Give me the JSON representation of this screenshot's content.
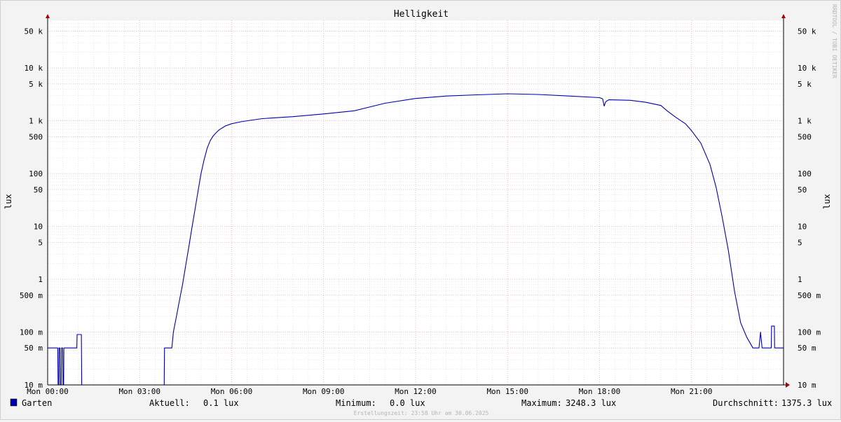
{
  "chart_data": {
    "type": "line",
    "title": "Helligkeit",
    "ylabel": "lux",
    "ylabel_right": "lux",
    "yscale": "log",
    "ylim": [
      0.01,
      80000
    ],
    "xlim_hours": [
      0,
      24
    ],
    "x_tick_labels": [
      "Mon 00:00",
      "Mon 03:00",
      "Mon 06:00",
      "Mon 09:00",
      "Mon 12:00",
      "Mon 15:00",
      "Mon 18:00",
      "Mon 21:00"
    ],
    "x_tick_hours": [
      0,
      3,
      6,
      9,
      12,
      15,
      18,
      21
    ],
    "y_ticks": [
      {
        "value": 50000,
        "label": "50 k"
      },
      {
        "value": 10000,
        "label": "10 k"
      },
      {
        "value": 5000,
        "label": "5 k"
      },
      {
        "value": 1000,
        "label": "1 k"
      },
      {
        "value": 500,
        "label": "500"
      },
      {
        "value": 100,
        "label": "100"
      },
      {
        "value": 50,
        "label": "50"
      },
      {
        "value": 10,
        "label": "10"
      },
      {
        "value": 5,
        "label": "5"
      },
      {
        "value": 1,
        "label": "1"
      },
      {
        "value": 0.5,
        "label": "500 m"
      },
      {
        "value": 0.1,
        "label": "100 m"
      },
      {
        "value": 0.05,
        "label": "50 m"
      },
      {
        "value": 0.01,
        "label": "10 m"
      }
    ],
    "grid": true,
    "series": [
      {
        "name": "Garten",
        "color": "#0000aa",
        "x": [
          0,
          0.33,
          0.34,
          0.36,
          0.37,
          0.4,
          0.41,
          0.44,
          0.45,
          0.49,
          0.5,
          0.52,
          0.53,
          0.95,
          0.96,
          1.1,
          1.11,
          3.8,
          3.81,
          4.05,
          4.1,
          4.2,
          4.3,
          4.4,
          4.5,
          4.6,
          4.7,
          4.8,
          4.9,
          5.0,
          5.1,
          5.2,
          5.3,
          5.4,
          5.5,
          5.6,
          5.8,
          6.0,
          6.3,
          6.6,
          7.0,
          7.5,
          8.0,
          9.0,
          10.0,
          11.0,
          12.0,
          13.0,
          14.0,
          15.0,
          16.0,
          17.0,
          18.0,
          18.1,
          18.15,
          18.2,
          18.3,
          19.0,
          19.5,
          20.0,
          20.2,
          20.5,
          20.8,
          21.0,
          21.3,
          21.6,
          21.8,
          22.0,
          22.2,
          22.4,
          22.6,
          22.8,
          23.0,
          23.1,
          23.2,
          23.25,
          23.3,
          23.5,
          23.6,
          23.61,
          23.7,
          23.71,
          24.0
        ],
        "y": [
          0.05,
          0.05,
          0.01,
          0.01,
          0.05,
          0.05,
          0.01,
          0.01,
          0.05,
          0.05,
          0.01,
          0.01,
          0.05,
          0.05,
          0.09,
          0.09,
          0.01,
          0.01,
          0.05,
          0.05,
          0.1,
          0.2,
          0.4,
          0.8,
          1.8,
          4,
          9,
          20,
          45,
          100,
          180,
          300,
          420,
          520,
          600,
          680,
          800,
          880,
          960,
          1020,
          1100,
          1150,
          1200,
          1350,
          1550,
          2150,
          2650,
          2950,
          3100,
          3248.3,
          3150,
          2950,
          2750,
          2600,
          1900,
          2300,
          2500,
          2450,
          2250,
          1950,
          1550,
          1150,
          880,
          650,
          380,
          150,
          55,
          15,
          3.5,
          0.6,
          0.15,
          0.08,
          0.05,
          0.05,
          0.05,
          0.1,
          0.05,
          0.05,
          0.05,
          0.13,
          0.13,
          0.05,
          0.05
        ],
        "current": "0.1 lux",
        "minimum": "0.0 lux",
        "maximum": "3248.3 lux",
        "average": "1375.3 lux"
      }
    ]
  },
  "legend": {
    "name": "Garten",
    "current_label": "Aktuell:",
    "current_value": "0.1 lux",
    "min_label": "Minimum:",
    "min_value": "0.0 lux",
    "max_label": "Maximum:",
    "max_value": "3248.3 lux",
    "avg_label": "Durchschnitt:",
    "avg_value": "1375.3 lux"
  },
  "footer": "Erstellungszeit: 23:58 Uhr am 30.06.2025",
  "watermark": "RRDTOOL / TOBI OETIKER",
  "colors": {
    "line": "#0000aa",
    "major_grid": "#f0a0a0",
    "minor_grid": "#d8d8d8",
    "plot_bg": "#ffffff",
    "page_bg": "#f3f3f3",
    "arrow": "#aa0000"
  }
}
